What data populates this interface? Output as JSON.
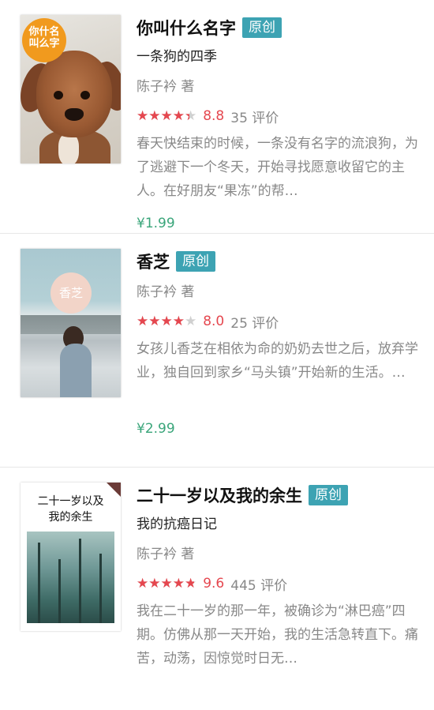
{
  "books": [
    {
      "title": "你叫什么名字",
      "badge": "原创",
      "subtitle": "一条狗的四季",
      "author": "陈子衿 著",
      "rating": 8.8,
      "rating_text": "8.8",
      "reviews": "35 评价",
      "description": "春天快结束的时候，一条没有名字的流浪狗，为了逃避下一个冬天，开始寻找愿意收留它的主人。在好朋友“果冻”的帮…",
      "price": "¥1.99",
      "cover_text": "你什名叫么字"
    },
    {
      "title": "香芝",
      "badge": "原创",
      "subtitle": "",
      "author": "陈子衿 著",
      "rating": 8.0,
      "rating_text": "8.0",
      "reviews": "25 评价",
      "description": "女孩儿香芝在相依为命的奶奶去世之后，放弃学业，独自回到家乡“马头镇”开始新的生活。…",
      "price": "¥2.99",
      "cover_text": "香芝"
    },
    {
      "title": "二十一岁以及我的余生",
      "badge": "原创",
      "subtitle": "我的抗癌日记",
      "author": "陈子衿 著",
      "rating": 9.6,
      "rating_text": "9.6",
      "reviews": "445 评价",
      "description": "我在二十一岁的那一年，被确诊为“淋巴癌”四期。仿佛从那一天开始，我的生活急转直下。痛苦，动荡，因惊觉时日无…",
      "price": "",
      "cover_text": "二十一岁以及我的余生"
    }
  ],
  "colors": {
    "badge": "#3da3b3",
    "stars": "#e5474f",
    "price": "#3aa57a"
  },
  "star_glyphs": "★★★★★"
}
